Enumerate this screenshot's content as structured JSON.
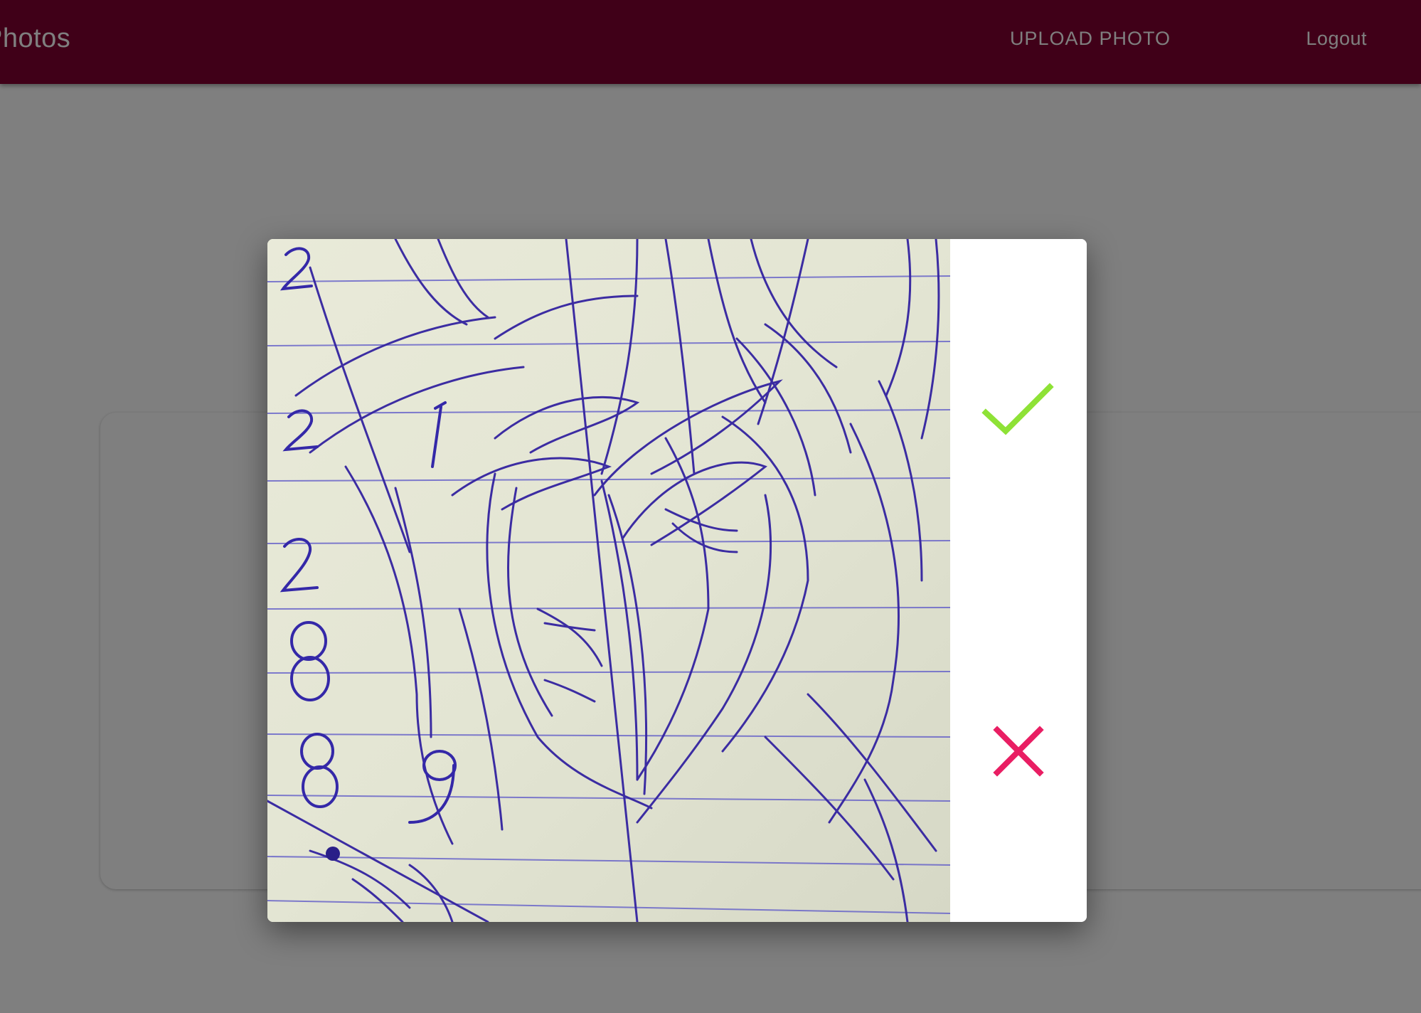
{
  "appbar": {
    "title": "Photos",
    "upload_label": "UPLOAD PHOTO",
    "logout_label": "Logout",
    "color": "#800030"
  },
  "dialog": {
    "image_alt": "Ballpoint pen sketch on lined notebook paper",
    "confirm_icon": "check-icon",
    "cancel_icon": "close-icon",
    "confirm_color": "#8EE236",
    "cancel_color": "#E91E63"
  },
  "sketch_margin_numbers": [
    "2",
    "2",
    "2",
    "8",
    "8",
    "9",
    "1"
  ]
}
